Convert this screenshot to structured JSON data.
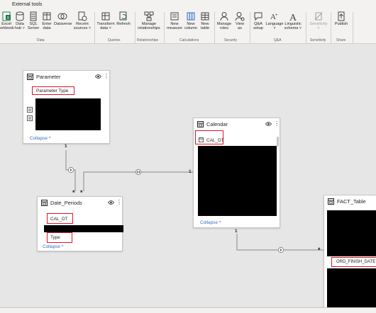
{
  "ribbon": {
    "tab_external_tools": "External tools",
    "buttons": {
      "excel_workbook": [
        "Excel",
        "orkbook"
      ],
      "data_hub": [
        "Data",
        "hub ˅"
      ],
      "sql_server": [
        "SQL",
        "Server"
      ],
      "enter_data": [
        "Enter",
        "data"
      ],
      "dataverse": [
        "Dataverse",
        ""
      ],
      "recent_sources": [
        "Recent",
        "sources ˅"
      ],
      "transform_data": [
        "Transform",
        "data ˅"
      ],
      "refresh": [
        "Refresh",
        ""
      ],
      "manage_relationships": [
        "Manage",
        "relationships"
      ],
      "new_measure": [
        "New",
        "measure"
      ],
      "new_column": [
        "New",
        "column"
      ],
      "new_table": [
        "New",
        "table"
      ],
      "manage_roles": [
        "Manage",
        "roles"
      ],
      "view_as": [
        "View",
        "as"
      ],
      "qa_setup": [
        "Q&A",
        "setup"
      ],
      "language": [
        "Language",
        "˅"
      ],
      "linguistic_schema": [
        "Linguistic",
        "schema ˅"
      ],
      "sensitivity": [
        "Sensitivity",
        "˅"
      ],
      "publish": [
        "Publish",
        ""
      ]
    },
    "groups": {
      "data": "Data",
      "queries": "Queries",
      "relationships": "Relationships",
      "calculations": "Calculations",
      "security": "Security",
      "qa": "Q&A",
      "sensitivity": "Sensitivity",
      "share": "Share"
    }
  },
  "cards": {
    "parameter": {
      "title": "Parameter",
      "field": "Parameter Type",
      "collapse": "Collapse"
    },
    "calendar": {
      "title": "Calendar",
      "field": "CAL_DT",
      "collapse": "Collapse"
    },
    "date_periods": {
      "title": "Date_Periods",
      "field1": "CAL_DT",
      "field2": "Type",
      "collapse": "Collapse"
    },
    "fact_table": {
      "title": "FACT_Table",
      "field": "ORD_FINISH_DATE"
    }
  },
  "relationships": {
    "one": "1",
    "many": "*"
  },
  "colors": {
    "highlight_red": "#e81123",
    "link_blue": "#2f6fbf",
    "canvas": "#e6e6e6"
  },
  "icons": [
    "table-icon",
    "eye-icon",
    "more-icon",
    "chevron-up-icon",
    "filter-arrow-icon"
  ]
}
